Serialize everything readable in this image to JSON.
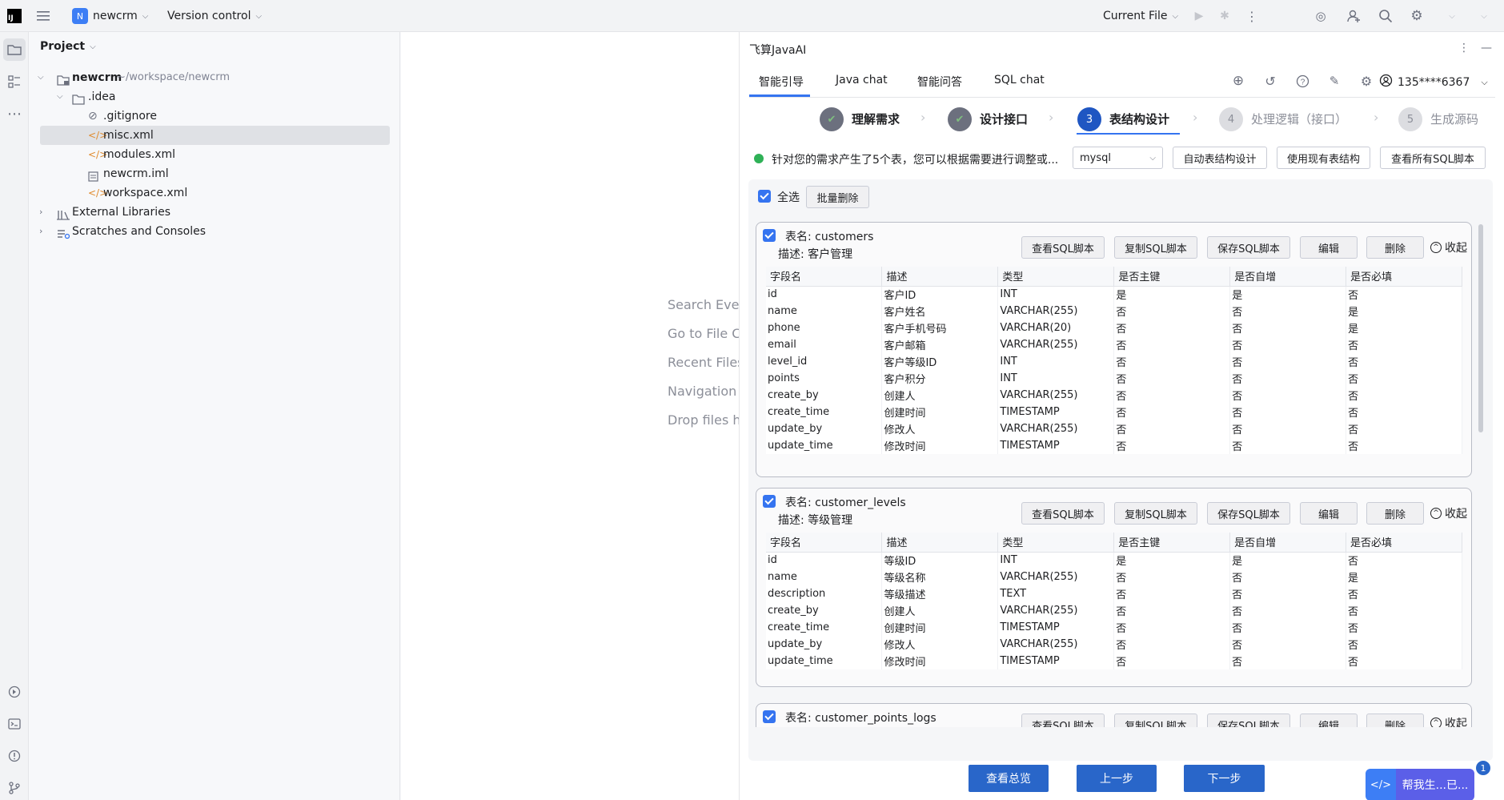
{
  "topbar": {
    "project_badge": "N",
    "project_name": "newcrm",
    "vcs": "Version control",
    "run_config": "Current File"
  },
  "project_panel": {
    "title": "Project",
    "tree": [
      {
        "label": "newcrm",
        "suffix": "~/workspace/newcrm",
        "icon": "folder-icon"
      },
      {
        "label": ".idea",
        "icon": "folder-icon"
      },
      {
        "label": ".gitignore",
        "icon": "ignore-file-icon"
      },
      {
        "label": "misc.xml",
        "icon": "xml-file-icon"
      },
      {
        "label": "modules.xml",
        "icon": "xml-file-icon"
      },
      {
        "label": "newcrm.iml",
        "icon": "iml-file-icon"
      },
      {
        "label": "workspace.xml",
        "icon": "xml-file-icon"
      },
      {
        "label": "External Libraries",
        "icon": "library-icon"
      },
      {
        "label": "Scratches and Consoles",
        "icon": "scratches-icon"
      }
    ]
  },
  "editor_hints": [
    "Search Ever",
    "Go to File C",
    "Recent Files",
    "Navigation I",
    "Drop files h"
  ],
  "ai_panel": {
    "title": "飞算JavaAI",
    "tabs": [
      "智能引导",
      "Java chat",
      "智能问答",
      "SQL chat"
    ],
    "user": "135****6367",
    "steps": [
      {
        "num": "✔",
        "label": "理解需求",
        "state": "done"
      },
      {
        "num": "✔",
        "label": "设计接口",
        "state": "done"
      },
      {
        "num": "3",
        "label": "表结构设计",
        "state": "active"
      },
      {
        "num": "4",
        "label": "处理逻辑（接口）",
        "state": "todo"
      },
      {
        "num": "5",
        "label": "生成源码",
        "state": "todo"
      }
    ],
    "notice": "针对您的需求产生了5个表，您可以根据需要进行调整或...",
    "db_select": "mysql",
    "actions": [
      "自动表结构设计",
      "使用现有表结构",
      "查看所有SQL脚本"
    ],
    "select_all": "全选",
    "batch_delete": "批量删除",
    "card_buttons": [
      "查看SQL脚本",
      "复制SQL脚本",
      "保存SQL脚本",
      "编辑",
      "删除"
    ],
    "collapse": "收起",
    "columns": [
      "字段名",
      "描述",
      "类型",
      "是否主键",
      "是否自增",
      "是否必填"
    ],
    "tables": [
      {
        "name": "表名: customers",
        "desc": "描述: 客户管理",
        "rows": [
          [
            "id",
            "客户ID",
            "INT",
            "是",
            "是",
            "否"
          ],
          [
            "name",
            "客户姓名",
            "VARCHAR(255)",
            "否",
            "否",
            "是"
          ],
          [
            "phone",
            "客户手机号码",
            "VARCHAR(20)",
            "否",
            "否",
            "是"
          ],
          [
            "email",
            "客户邮箱",
            "VARCHAR(255)",
            "否",
            "否",
            "否"
          ],
          [
            "level_id",
            "客户等级ID",
            "INT",
            "否",
            "否",
            "否"
          ],
          [
            "points",
            "客户积分",
            "INT",
            "否",
            "否",
            "否"
          ],
          [
            "create_by",
            "创建人",
            "VARCHAR(255)",
            "否",
            "否",
            "否"
          ],
          [
            "create_time",
            "创建时间",
            "TIMESTAMP",
            "否",
            "否",
            "否"
          ],
          [
            "update_by",
            "修改人",
            "VARCHAR(255)",
            "否",
            "否",
            "否"
          ],
          [
            "update_time",
            "修改时间",
            "TIMESTAMP",
            "否",
            "否",
            "否"
          ]
        ]
      },
      {
        "name": "表名: customer_levels",
        "desc": "描述: 等级管理",
        "rows": [
          [
            "id",
            "等级ID",
            "INT",
            "是",
            "是",
            "否"
          ],
          [
            "name",
            "等级名称",
            "VARCHAR(255)",
            "否",
            "否",
            "是"
          ],
          [
            "description",
            "等级描述",
            "TEXT",
            "否",
            "否",
            "否"
          ],
          [
            "create_by",
            "创建人",
            "VARCHAR(255)",
            "否",
            "否",
            "否"
          ],
          [
            "create_time",
            "创建时间",
            "TIMESTAMP",
            "否",
            "否",
            "否"
          ],
          [
            "update_by",
            "修改人",
            "VARCHAR(255)",
            "否",
            "否",
            "否"
          ],
          [
            "update_time",
            "修改时间",
            "TIMESTAMP",
            "否",
            "否",
            "否"
          ]
        ]
      },
      {
        "name": "表名: customer_points_logs",
        "desc": "",
        "rows": []
      }
    ],
    "footer": [
      "查看总览",
      "上一步",
      "下一步"
    ],
    "helper": "帮我生...已...",
    "helper_badge": "1"
  },
  "colors": {
    "accent": "#3574f0",
    "primary_button": "#2966c9",
    "success": "#2fb157"
  }
}
